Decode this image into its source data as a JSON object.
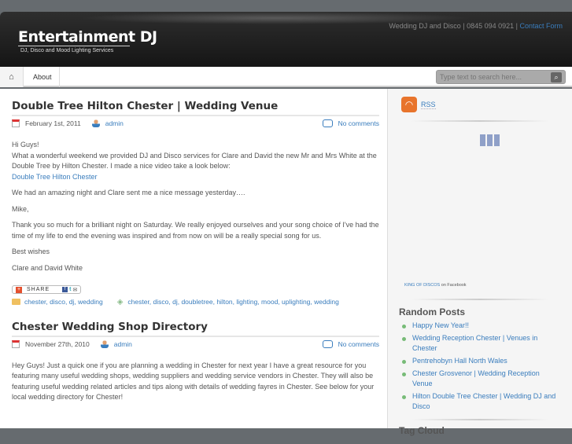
{
  "header": {
    "title": "Entertainment DJ",
    "tagline": "DJ, Disco and Mood Lighting Services",
    "toplinks_text": "Wedding DJ and Disco | 0845 094 0921 | ",
    "contact_link": "Contact Form"
  },
  "nav": {
    "items": [
      {
        "label": "About"
      }
    ],
    "search_placeholder": "Type text to search here..."
  },
  "posts": [
    {
      "title": "Double Tree Hilton Chester | Wedding Venue",
      "date": "February 1st, 2011",
      "author": "admin",
      "comments": "No comments",
      "paragraphs": [
        "Hi Guys!",
        "What a wonderful weekend we provided DJ and Disco services for Clare and David the new Mr and Mrs White at the Double Tree by Hilton Chester. I made a nice video take a look below:",
        "We had an amazing night and Clare sent me a nice message yesterday….",
        "Mike,",
        "Thank you so much for a brilliant night on Saturday. We really enjoyed ourselves and your song choice of I've had the time of my life to end the evening was inspired and from now on will be a really special song for us.",
        "Best wishes",
        "Clare and David White"
      ],
      "link": "Double Tree Hilton Chester",
      "share_label": "SHARE",
      "categories": "chester, disco, dj, wedding",
      "tags": "chester, disco, dj, doubletree, hilton, lighting, mood, uplighting, wedding"
    },
    {
      "title": "Chester Wedding Shop Directory",
      "date": "November 27th, 2010",
      "author": "admin",
      "comments": "No comments",
      "paragraphs": [
        "Hey Guys! Just a quick one if you are planning a wedding in Chester for next year I have a great resource for you featuring many useful wedding shops, wedding suppliers and wedding service vendors in Chester. They will also be featuring useful wedding related articles and tips along with details of wedding fayres in Chester. See below for your local wedding directory for Chester!"
      ]
    }
  ],
  "sidebar": {
    "rss": "RSS",
    "facebook_link": "KING OF DISCOS",
    "facebook_suffix": " on Facebook",
    "random_title": "Random Posts",
    "random_posts": [
      "Happy New Year!!",
      "Wedding Reception Chester | Venues in Chester",
      "Pentrehobyn Hall North Wales",
      "Chester Grosvenor | Wedding Reception Venue",
      "Hilton Double Tree Chester | Wedding DJ and Disco"
    ],
    "tag_cloud_title": "Tag Cloud"
  }
}
